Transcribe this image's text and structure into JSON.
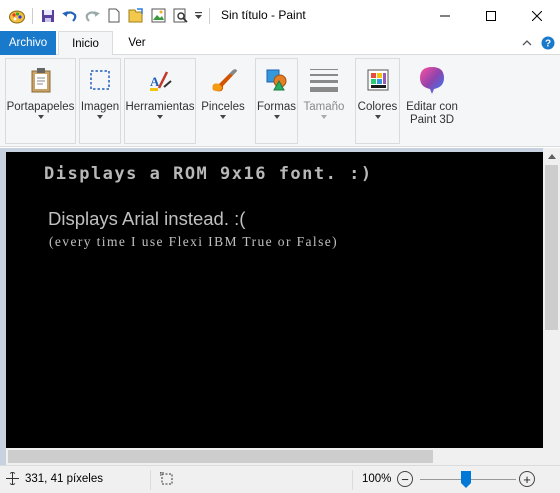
{
  "window": {
    "title": "Sin título - Paint"
  },
  "quick_access": {
    "icons": [
      "paint-app-icon",
      "save-icon",
      "undo-icon",
      "redo-icon",
      "new-file-icon",
      "open-file-icon",
      "image-icon",
      "print-preview-icon",
      "customize-dropdown-icon"
    ]
  },
  "tabs": [
    {
      "label": "Archivo"
    },
    {
      "label": "Inicio"
    },
    {
      "label": "Ver"
    }
  ],
  "ribbon": {
    "groups": [
      {
        "label": "Portapapeles",
        "icon": "clipboard-icon"
      },
      {
        "label": "Imagen",
        "icon": "select-icon"
      },
      {
        "label": "Herramientas",
        "icon": "tools-icon"
      },
      {
        "label": "Pinceles",
        "icon": "brush-icon"
      },
      {
        "label": "Formas",
        "icon": "shapes-icon"
      },
      {
        "label": "Tamaño",
        "icon": "line-size-icon"
      },
      {
        "label": "Colores",
        "icon": "colors-icon"
      },
      {
        "label": "Editar con Paint 3D",
        "label_line1": "Editar con",
        "label_line2": "Paint 3D",
        "icon": "paint3d-icon"
      }
    ]
  },
  "canvas": {
    "line_rom": "Displays a ROM 9x16 font. :)",
    "line_arial": "Displays Arial instead. :(",
    "line_flexi": "(every time I use Flexi IBM True or False)"
  },
  "status": {
    "position": "331, 41 píxeles",
    "zoom": "100%"
  },
  "colors": {
    "file_tab": "#1979ca",
    "ribbon_bg": "#f5f6f7",
    "canvas_bg": "#000000",
    "workspace_bg": "#c8d1e0",
    "accent": "#0078d7"
  }
}
